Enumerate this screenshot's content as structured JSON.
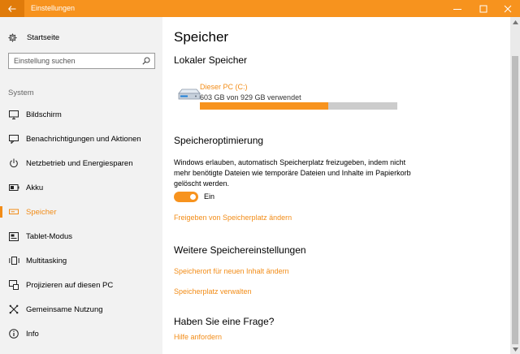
{
  "window": {
    "title": "Einstellungen"
  },
  "sidebar": {
    "home_label": "Startseite",
    "search_placeholder": "Einstellung suchen",
    "section_label": "System",
    "items": [
      {
        "label": "Bildschirm",
        "icon": "monitor-icon"
      },
      {
        "label": "Benachrichtigungen und Aktionen",
        "icon": "notification-icon"
      },
      {
        "label": "Netzbetrieb und Energiesparen",
        "icon": "power-icon"
      },
      {
        "label": "Akku",
        "icon": "battery-icon"
      },
      {
        "label": "Speicher",
        "icon": "storage-icon",
        "active": true
      },
      {
        "label": "Tablet-Modus",
        "icon": "tablet-mode-icon"
      },
      {
        "label": "Multitasking",
        "icon": "multitasking-icon"
      },
      {
        "label": "Projizieren auf diesen PC",
        "icon": "project-icon"
      },
      {
        "label": "Gemeinsame Nutzung",
        "icon": "share-icon"
      },
      {
        "label": "Info",
        "icon": "info-icon"
      }
    ]
  },
  "main": {
    "page_title": "Speicher",
    "local_storage": {
      "heading": "Lokaler Speicher",
      "drive_name": "Dieser PC (C:)",
      "usage_text": "603 GB von 929 GB verwendet",
      "used_fraction": 0.649
    },
    "optimization": {
      "heading": "Speicheroptimierung",
      "description": "Windows erlauben, automatisch Speicherplatz freizugeben, indem nicht mehr benötigte Dateien wie temporäre Dateien und Inhalte im Papierkorb gelöscht werden.",
      "toggle_label": "Ein",
      "toggle_on": true,
      "link": "Freigeben von Speicherplatz ändern"
    },
    "more_settings": {
      "heading": "Weitere Speichereinstellungen",
      "link1": "Speicherort für neuen Inhalt ändern",
      "link2": "Speicherplatz verwalten"
    },
    "question": {
      "heading": "Haben Sie eine Frage?",
      "link": "Hilfe anfordern"
    }
  },
  "colors": {
    "accent": "#f7931e",
    "accent_text": "#f28c17",
    "sidebar_bg": "#f2f2f2"
  }
}
